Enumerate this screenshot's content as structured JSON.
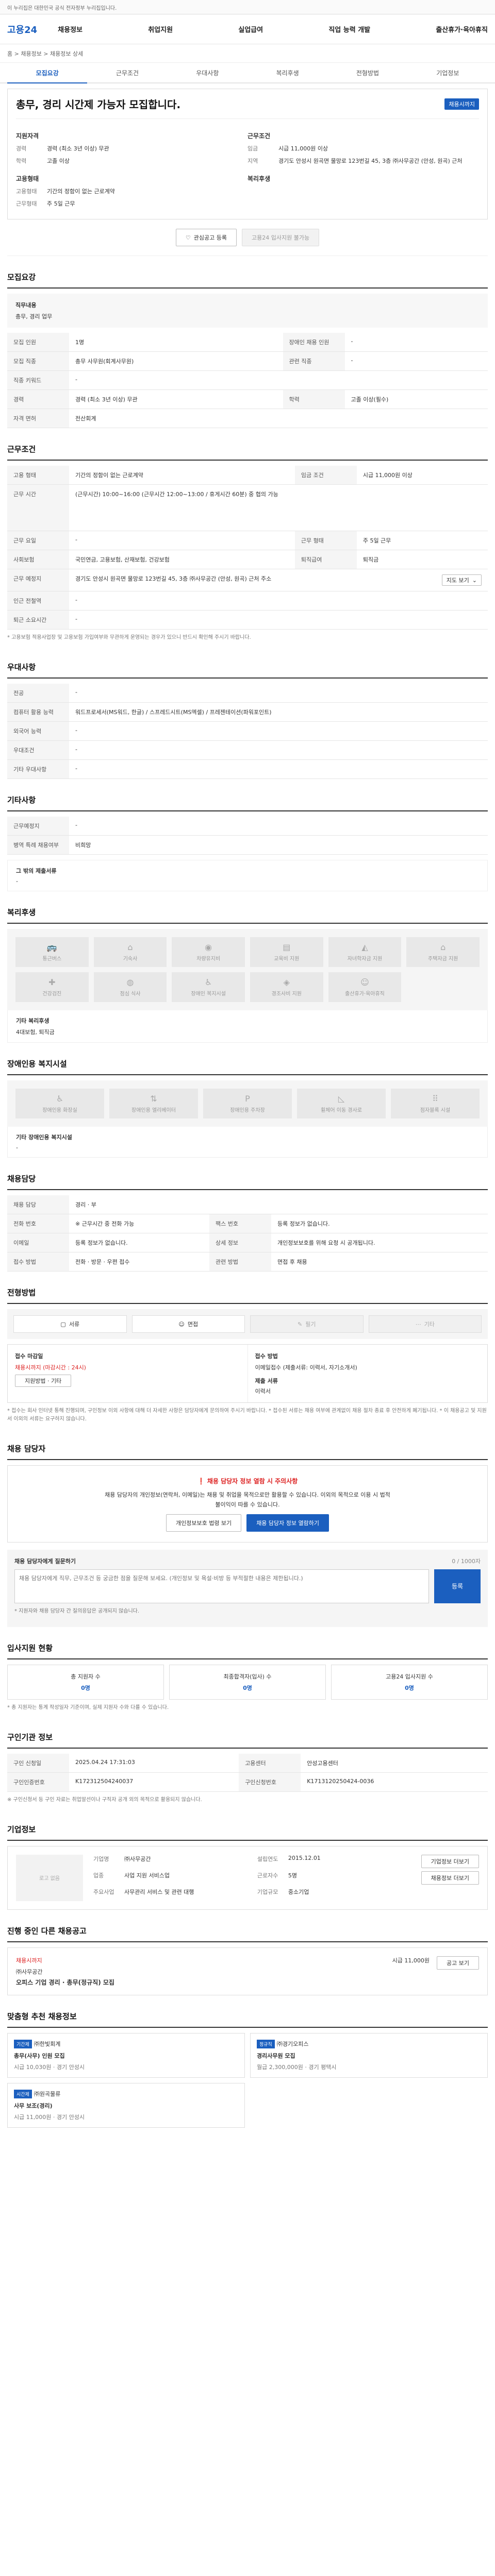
{
  "topbar": "이 누리집은 대한민국 공식 전자정부 누리집입니다.",
  "logo": "고용24",
  "gnb": [
    "채용정보",
    "취업지원",
    "실업급여",
    "직업 능력 개발",
    "출산휴가·육아휴직"
  ],
  "breadcrumb": "홈 > 채용정보 > 채용정보 상세",
  "tabs": [
    "모집요강",
    "근무조건",
    "우대사항",
    "복리후생",
    "전형방법",
    "기업정보"
  ],
  "job": {
    "title": "총무, 경리 시간제 가능자 모집합니다.",
    "badge": "채용시까지",
    "recruit_head": "지원자격",
    "recruit": [
      {
        "k": "경력",
        "v": "경력 (최소 3년 이상) 무관"
      },
      {
        "k": "학력",
        "v": "고졸 이상"
      }
    ],
    "cond_head": "근무조건",
    "cond": [
      {
        "k": "임금",
        "v": "시급 11,000원 이상"
      },
      {
        "k": "지역",
        "v": "경기도 안성시 원곡면 물망로 123번길 45, 3층 ㈜사무공간 (안성, 원곡) 근처"
      }
    ],
    "type_head": "고용형태",
    "type": [
      {
        "k": "고용형태",
        "v": "기간의 정함이 없는 근로계약"
      },
      {
        "k": "근무형태",
        "v": "주 5일 근무"
      }
    ],
    "welfare_head": "복리후생",
    "btn_interest": "관심공고 등록",
    "btn_apply_disabled": "고용24 입사지원 불가능"
  },
  "recruit_sec": {
    "title": "모집요강",
    "duty_label": "직무내용",
    "duty": "총무, 경리 업무",
    "rows": [
      {
        "k": "모집 인원",
        "v": "1명",
        "k2": "장애인 채용 인원",
        "v2": "-"
      },
      {
        "k": "모집 직종",
        "v": "총무 사무원(회계사무원)",
        "k2": "관련 직종",
        "v2": "-"
      },
      {
        "k": "직종 키워드",
        "v": "-",
        "k2": "",
        "v2": ""
      },
      {
        "k": "경력",
        "v": "경력 (최소 3년 이상) 무관",
        "k2": "학력",
        "v2": "고졸 이상(필수)"
      },
      {
        "k": "자격 면허",
        "v": "전산회계",
        "k2": "",
        "v2": ""
      }
    ]
  },
  "cond_sec": {
    "title": "근무조건",
    "rows": [
      {
        "k": "고용 형태",
        "v": "기간의 정함이 없는 근로계약",
        "k2": "임금 조건",
        "v2": "시급 11,000원 이상"
      },
      {
        "k": "근무 시간",
        "v": "(근무시간) 10:00~16:00 (근무시간 12:00~13:00 / 휴게시간 60분) 중 협의 가능",
        "k2": "",
        "v2": ""
      },
      {
        "k": "근무 요일",
        "v": "-",
        "k2": "근무 형태",
        "v2": "주 5일 근무"
      },
      {
        "k": "사회보험",
        "v": "국민연금, 고용보험, 산재보험, 건강보험",
        "k2": "퇴직급여",
        "v2": "퇴직금"
      },
      {
        "k": "근무 예정지",
        "v": "경기도 안성시 원곡면 물망로 123번길 45, 3층 ㈜사무공간 (안성, 원곡) 근처 주소",
        "k2": "",
        "v2": ""
      },
      {
        "k": "인근 전철역",
        "v": "-",
        "k2": "",
        "v2": ""
      },
      {
        "k": "퇴근 소요시간",
        "v": "-",
        "k2": "",
        "v2": ""
      }
    ],
    "map_btn": "지도 보기",
    "note": "* 고용보험 적용사업장 및 고용보험 가입여부와 무관하게 운영되는 경우가 있으니 반드시 확인해 주시기 바랍니다."
  },
  "pref_sec": {
    "title": "우대사항",
    "rows": [
      {
        "k": "전공",
        "v": "-"
      },
      {
        "k": "컴퓨터 활용 능력",
        "v": "워드프로세서(MS워드, 한글) / 스프레드시트(MS엑셀) / 프레젠테이션(파워포인트)"
      },
      {
        "k": "외국어 능력",
        "v": "-"
      },
      {
        "k": "우대조건",
        "v": "-"
      },
      {
        "k": "기타 우대사항",
        "v": "-"
      }
    ]
  },
  "extra_sec": {
    "title": "기타사항",
    "rows": [
      {
        "k": "근무예정지",
        "v": "-"
      },
      {
        "k": "병역 특례 채용여부",
        "v": "비희망"
      }
    ],
    "etc_label": "그 밖의 제출서류",
    "etc": "-"
  },
  "welfare_sec": {
    "title": "복리후생",
    "items": [
      "통근버스",
      "기숙사",
      "차량유지비",
      "교육비 지원",
      "자녀학자금 지원",
      "주택자금 지원",
      "건강검진",
      "점심 식사",
      "장애인 복지시설",
      "경조사비 지원",
      "출산휴가·육아휴직"
    ],
    "other_label": "기타 복리후생",
    "other": "4대보험, 퇴직금"
  },
  "disabled_sec": {
    "title": "장애인용 복지시설",
    "items": [
      "장애인용 화장실",
      "장애인용 엘리베이터",
      "장애인용 주차장",
      "휠체어 이동 경사로",
      "점자블록 시설"
    ],
    "other_label": "기타 장애인용 복지시설",
    "other": "-"
  },
  "contact_sec": {
    "title": "채용담당",
    "rows": [
      {
        "k": "채용 담당",
        "v": "경리 · 부",
        "k2": "",
        "v2": ""
      },
      {
        "k": "전화 번호",
        "v": "※ 근무시간 중 전화 가능",
        "k2": "팩스 번호",
        "v2": "등록 정보가 없습니다."
      },
      {
        "k": "이메일",
        "v": "등록 정보가 없습니다.",
        "k2": "상세 정보",
        "v2": "개인정보보호를 위해 요청 시 공개됩니다."
      },
      {
        "k": "접수 방법",
        "v": "전화 · 방문 · 우편 접수",
        "k2": "관련 방법",
        "v2": "면접 후 채용"
      }
    ]
  },
  "process_sec": {
    "title": "전형방법",
    "steps": [
      "서류",
      "면접",
      "필기",
      "기타"
    ],
    "apply_title": "접수 마감일",
    "apply_date": "채용시까지 (마감시간 : 24시)",
    "apply_btn": "지원방법 · 기타",
    "method_title": "접수 방법",
    "method": "이메일접수 (제출서류: 이력서, 자기소개서)",
    "doc_title": "제출 서류",
    "doc": "이력서",
    "notes": "* 접수는 회사 인터넷 통해 진행되며, 구인정보 이외 사항에 대해 더 자세한 사항은 담당자에게 문의하여 주시기 바랍니다. * 접수된 서류는 채용 여부에 관계없이 채용 절차 종료 후 안전하게 폐기됩니다. * 이 채용공고 및 지원서 이외의 서류는 요구하지 않습니다."
  },
  "contact_card": {
    "title": "채용 담당자",
    "warn": "채용 담당자 정보 열람 시 주의사항",
    "body": "채용 담당자의 개인정보(연락처, 이메일)는 채용 및 취업을 목적으로만 활용할 수 있습니다. 이외의 목적으로 이용 시 법적 불이익이 따를 수 있습니다.",
    "btn1": "개인정보보호 법령 보기",
    "btn2": "채용 담당자 정보 열람하기",
    "q_title": "채용 담당자에게 질문하기",
    "q_count": "0 / 1000자",
    "q_placeholder": "채용 담당자에게 직무, 근무조건 등 궁금한 점을 질문해 보세요. (개인정보 및 욕설·비방 등 부적절한 내용은 제한됩니다.)",
    "q_btn": "등록",
    "q_notes": "* 지원자와 채용 담당자 간 질의응답은 공개되지 않습니다."
  },
  "stats_sec": {
    "title": "입사지원 현황",
    "items": [
      {
        "k": "총 지원자 수",
        "v": "0명"
      },
      {
        "k": "최종합격자(입사) 수",
        "v": "0명"
      },
      {
        "k": "고용24 입사지원 수",
        "v": "0명"
      }
    ],
    "note": "* 총 지원자는 통계 작성일자 기준이며, 실제 지원자 수와 다를 수 있습니다."
  },
  "info_sec": {
    "title": "구인기관 정보",
    "rows": [
      {
        "k": "구인 신청일",
        "v": "2025.04.24 17:31:03",
        "k2": "고용센터",
        "v2": "안성고용센터"
      },
      {
        "k": "구인인증번호",
        "v": "K172312504240037",
        "k2": "구인신청번호",
        "v2": "K1713120250424-0036"
      }
    ],
    "note": "※ 구인신청서 등 구인 자료는 취업알선이나 구직자 공개 외의 목적으로 활용되지 않습니다."
  },
  "company_sec": {
    "title": "기업정보",
    "logo_ph": "로고 없음",
    "rows": [
      {
        "k": "기업명",
        "v": "㈜사무공간"
      },
      {
        "k": "업종",
        "v": "사업 지원 서비스업"
      },
      {
        "k": "주요사업",
        "v": "사무관리 서비스 및 관련 대행"
      },
      {
        "k": "설립연도",
        "v": "2015.12.01"
      },
      {
        "k": "근로자수",
        "v": "5명"
      },
      {
        "k": "기업규모",
        "v": "중소기업"
      }
    ],
    "btn1": "기업정보 더보기",
    "btn2": "채용정보 더보기"
  },
  "other_sec": {
    "title": "진행 중인 다른 채용공고",
    "company": "㈜사무공간",
    "job": "오피스 기업 경리 · 총무(정규직) 모집",
    "pay": "시급 11,000원",
    "status": "채용시까지",
    "btn": "공고 보기"
  },
  "rec_sec": {
    "title": "맞춤형 추천 채용정보",
    "items": [
      {
        "tag": "기간제",
        "co": "㈜한빛회계",
        "title": "총무(사무) 인원 모집",
        "pay": "시급 10,030원",
        "loc": "경기 안성시"
      },
      {
        "tag": "정규직",
        "co": "㈜경기오피스",
        "title": "경리사무원 모집",
        "pay": "월급 2,300,000원",
        "loc": "경기 평택시"
      },
      {
        "tag": "시간제",
        "co": "㈜원곡물류",
        "title": "사무 보조(경리)",
        "pay": "시급 11,000원",
        "loc": "경기 안성시"
      }
    ]
  }
}
